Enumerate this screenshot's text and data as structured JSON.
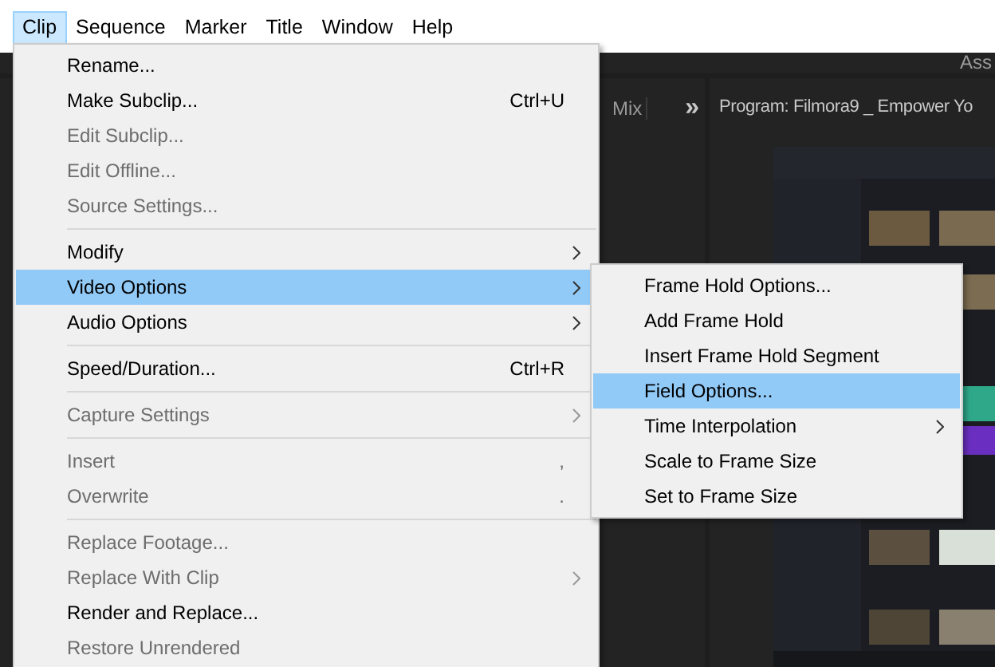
{
  "menubar": [
    {
      "label": "Clip",
      "selected": true
    },
    {
      "label": "Sequence",
      "selected": false
    },
    {
      "label": "Marker",
      "selected": false
    },
    {
      "label": "Title",
      "selected": false
    },
    {
      "label": "Window",
      "selected": false
    },
    {
      "label": "Help",
      "selected": false
    }
  ],
  "workspace": {
    "tab_label": "Ass",
    "panel_label": "Mix",
    "panel_overflow": "»",
    "program_title": "Program: Filmora9 _ Empower Yo"
  },
  "menu": {
    "items": [
      {
        "kind": "item",
        "label": "Rename...",
        "disabled": false,
        "selected": false
      },
      {
        "kind": "item",
        "label": "Make Subclip...",
        "shortcut": "Ctrl+U",
        "disabled": false,
        "selected": false
      },
      {
        "kind": "item",
        "label": "Edit Subclip...",
        "disabled": true,
        "selected": false
      },
      {
        "kind": "item",
        "label": "Edit Offline...",
        "disabled": true,
        "selected": false
      },
      {
        "kind": "item",
        "label": "Source Settings...",
        "disabled": true,
        "selected": false
      },
      {
        "kind": "separator"
      },
      {
        "kind": "item",
        "label": "Modify",
        "submenu": true,
        "disabled": false,
        "selected": false
      },
      {
        "kind": "item",
        "label": "Video Options",
        "submenu": true,
        "disabled": false,
        "selected": true
      },
      {
        "kind": "item",
        "label": "Audio Options",
        "submenu": true,
        "disabled": false,
        "selected": false
      },
      {
        "kind": "separator"
      },
      {
        "kind": "item",
        "label": "Speed/Duration...",
        "shortcut": "Ctrl+R",
        "disabled": false,
        "selected": false
      },
      {
        "kind": "separator"
      },
      {
        "kind": "item",
        "label": "Capture Settings",
        "submenu": true,
        "disabled": true,
        "selected": false
      },
      {
        "kind": "separator"
      },
      {
        "kind": "item",
        "label": "Insert",
        "shortcut": ",",
        "disabled": true,
        "selected": false
      },
      {
        "kind": "item",
        "label": "Overwrite",
        "shortcut": ".",
        "disabled": true,
        "selected": false
      },
      {
        "kind": "separator"
      },
      {
        "kind": "item",
        "label": "Replace Footage...",
        "disabled": true,
        "selected": false
      },
      {
        "kind": "item",
        "label": "Replace With Clip",
        "submenu": true,
        "disabled": true,
        "selected": false
      },
      {
        "kind": "item",
        "label": "Render and Replace...",
        "disabled": false,
        "selected": false
      },
      {
        "kind": "item",
        "label": "Restore Unrendered",
        "disabled": true,
        "selected": false
      }
    ]
  },
  "submenu": {
    "items": [
      {
        "kind": "item",
        "label": "Frame Hold Options...",
        "disabled": false,
        "selected": false
      },
      {
        "kind": "item",
        "label": "Add Frame Hold",
        "disabled": false,
        "selected": false
      },
      {
        "kind": "item",
        "label": "Insert Frame Hold Segment",
        "disabled": false,
        "selected": false
      },
      {
        "kind": "item",
        "label": "Field Options...",
        "disabled": false,
        "selected": true
      },
      {
        "kind": "item",
        "label": "Time Interpolation",
        "submenu": true,
        "disabled": false,
        "selected": false
      },
      {
        "kind": "item",
        "label": "Scale to Frame Size",
        "disabled": false,
        "selected": false
      },
      {
        "kind": "item",
        "label": "Set to Frame Size",
        "disabled": false,
        "selected": false
      }
    ]
  }
}
